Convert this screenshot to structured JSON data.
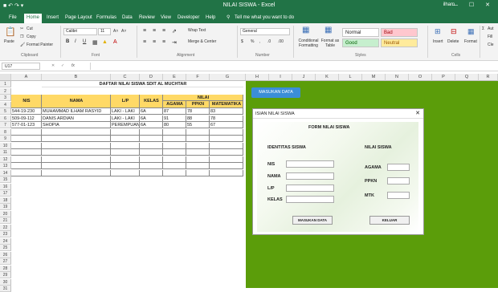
{
  "window": {
    "title": "NILAI SISWA - Excel",
    "user": "ilham",
    "controls": "— ☐ ✕",
    "quick_access": "■ ↶ ↷ ▾"
  },
  "tabs": [
    "File",
    "Home",
    "Insert",
    "Page Layout",
    "Formulas",
    "Data",
    "Review",
    "View",
    "Developer",
    "Help",
    "Tell me what you want to do"
  ],
  "ribbon": {
    "clipboard": {
      "paste": "Paste",
      "cut": "Cut",
      "copy": "Copy",
      "format_painter": "Format Painter",
      "label": "Clipboard"
    },
    "font": {
      "name": "Calibri",
      "size": "11",
      "bold": "B",
      "italic": "I",
      "underline": "U",
      "grow": "A˄",
      "shrink": "A˅",
      "label": "Font"
    },
    "alignment": {
      "wrap": "Wrap Text",
      "merge": "Merge & Center",
      "label": "Alignment"
    },
    "number": {
      "format": "General",
      "currency": "$",
      "percent": "%",
      "comma": ",",
      "inc_dec": ".0",
      "dec_dec": ".00",
      "label": "Number"
    },
    "styles": {
      "conditional": "Conditional Formatting",
      "format_table": "Format as Table",
      "normal": "Normal",
      "bad": "Bad",
      "good": "Good",
      "neutral": "Neutral",
      "label": "Styles"
    },
    "cells": {
      "insert": "Insert",
      "delete": "Delete",
      "format": "Format",
      "label": "Cells"
    },
    "editing": {
      "autosum": "Aut",
      "fill": "Fill",
      "clear": "Cle"
    }
  },
  "formula_bar": {
    "name_box": "U17",
    "fx": "fx",
    "value": ""
  },
  "columns": [
    "A",
    "B",
    "C",
    "D",
    "E",
    "F",
    "G",
    "H",
    "I",
    "J",
    "K",
    "L",
    "M",
    "N",
    "O",
    "P",
    "Q",
    "R"
  ],
  "rows": [
    "1",
    "2",
    "3",
    "4",
    "5",
    "6",
    "7",
    "8",
    "9",
    "10",
    "11",
    "12",
    "13",
    "14",
    "15",
    "16",
    "17",
    "18",
    "19",
    "20",
    "21",
    "22",
    "23",
    "24",
    "25",
    "26",
    "27",
    "28",
    "29",
    "30",
    "31"
  ],
  "sheet": {
    "title": "DAFTAR NILAI SISWA SDIT AL MUCHTAR",
    "headers": {
      "nis": "NIS",
      "nama": "NAMA",
      "lp": "L/P",
      "kelas": "KELAS",
      "nilai": "NILAI",
      "agama": "AGAMA",
      "ppkn": "PPKN",
      "matematika": "MATEMATIKA"
    },
    "data": [
      [
        "544-19-230",
        "MUHAMMAD ILHAM RASYID",
        "LAKI - LAKI",
        "6A",
        "87",
        "78",
        "83"
      ],
      [
        "509-09-112",
        "DANIS ARDIAN",
        "LAKI - LAKI",
        "6A",
        "91",
        "88",
        "78"
      ],
      [
        "577-01-123",
        "SHOPIA",
        "PEREMPUAN",
        "6A",
        "80",
        "55",
        "67"
      ]
    ]
  },
  "macro_button": "MASUKAN DATA",
  "userform": {
    "caption": "ISIAN NILAI SISWA",
    "close": "✕",
    "heading": "FORM NILAI SISWA",
    "identitas": "IDENTITAS SISWA",
    "nilai": "NILAI SISWA",
    "labels": {
      "nis": "NIS",
      "nama": "NAMA",
      "lp": "L/P",
      "kelas": "KELAS",
      "agama": "AGAMA",
      "ppkn": "PPKN",
      "mtk": "MTK"
    },
    "btn_submit": "MASUKAN DATA",
    "btn_exit": "KELUAR"
  }
}
